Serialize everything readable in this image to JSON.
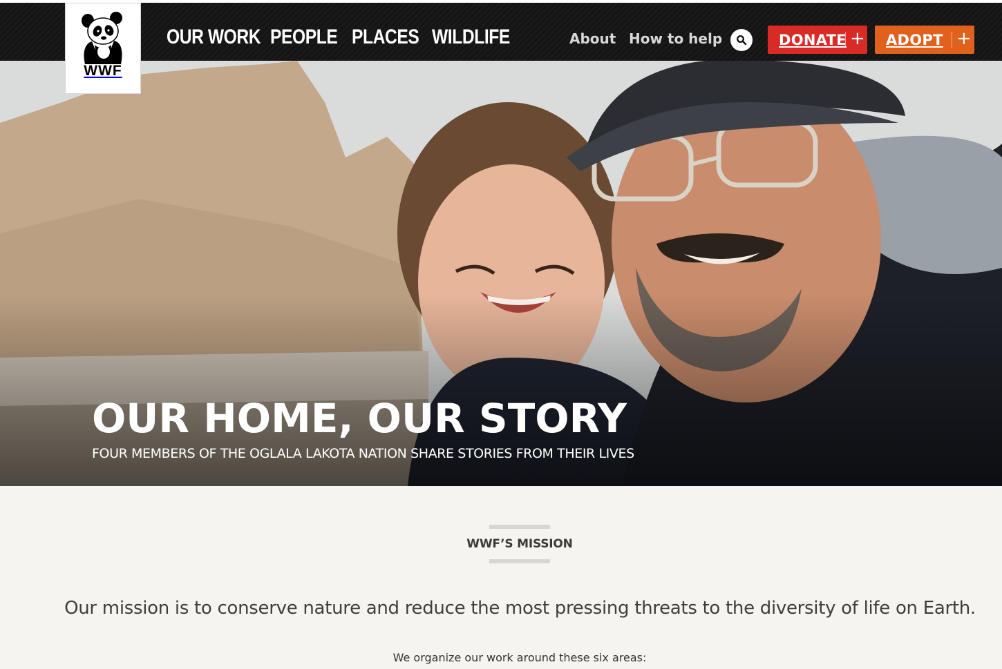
{
  "brand": {
    "logo_text": "WWF"
  },
  "nav": {
    "primary": [
      {
        "label": "OUR WORK"
      },
      {
        "label": "PEOPLE"
      },
      {
        "label": "PLACES"
      },
      {
        "label": "WILDLIFE"
      }
    ],
    "utility": [
      {
        "label": "About"
      },
      {
        "label": "How to help"
      }
    ],
    "search_icon": "search-icon",
    "donate_label": "DONATE",
    "adopt_label": "ADOPT",
    "plus_symbol": "+"
  },
  "hero": {
    "title": "OUR HOME, OUR STORY",
    "subtitle": "FOUR MEMBERS OF THE OGLALA LAKOTA NATION SHARE STORIES FROM THEIR LIVES"
  },
  "mission": {
    "label": "WWF’S MISSION",
    "statement": "Our mission is to conserve nature and reduce the most pressing threats to the diversity of life on Earth.",
    "organize_text": "We organize our work around these six areas:"
  },
  "colors": {
    "donate": "#d92b26",
    "adopt": "#e0611d",
    "nav_bg": "#141414",
    "page_bg": "#f5f4f0"
  }
}
